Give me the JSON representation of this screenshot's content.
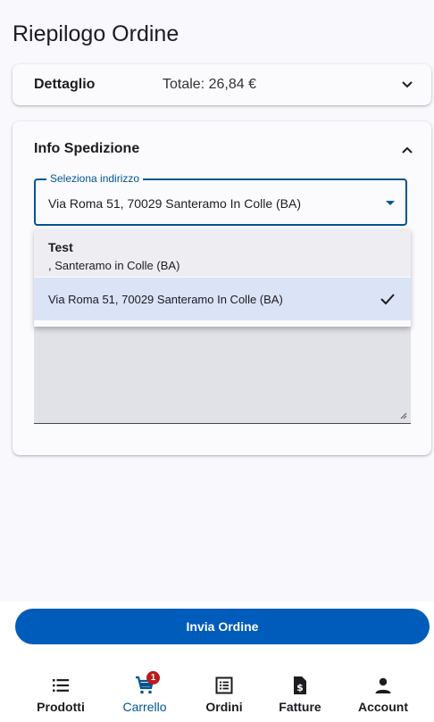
{
  "page": {
    "title": "Riepilogo Ordine"
  },
  "detail_card": {
    "label": "Dettaglio",
    "total": "Totale: 26,84 €"
  },
  "shipping_card": {
    "label": "Info Spedizione",
    "address_field": {
      "label": "Seleziona indirizzo",
      "value": "Via Roma 51, 70029 Santeramo In Colle (BA)"
    },
    "options": [
      {
        "title": "Test",
        "subtitle": ", Santeramo in Colle (BA)"
      },
      {
        "text": "Via Roma 51, 70029 Santeramo In Colle (BA)",
        "selected": true
      }
    ]
  },
  "submit": {
    "label": "Invia Ordine"
  },
  "nav": {
    "items": [
      {
        "label": "Prodotti",
        "icon": "list-icon"
      },
      {
        "label": "Carrello",
        "icon": "cart-icon",
        "badge": "1",
        "active": true
      },
      {
        "label": "Ordini",
        "icon": "orders-icon"
      },
      {
        "label": "Fatture",
        "icon": "invoice-icon"
      },
      {
        "label": "Account",
        "icon": "account-icon"
      }
    ]
  },
  "colors": {
    "primary": "#005cbb",
    "accent": "#00558f",
    "badge": "#ba1a1a"
  }
}
